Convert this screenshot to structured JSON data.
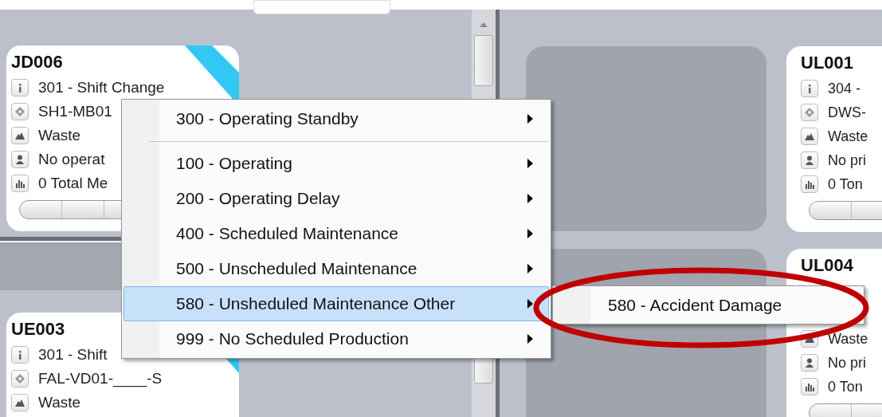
{
  "left_pane": {
    "cards": [
      {
        "title": "JD006",
        "color": "#33c8f4",
        "rows": [
          {
            "kind": "info",
            "text": "301 - Shift Change"
          },
          {
            "kind": "location",
            "text": "SH1-MB01"
          },
          {
            "kind": "material",
            "text": "Waste"
          },
          {
            "kind": "operator",
            "text": "No operat"
          },
          {
            "kind": "production",
            "text": "0 Total Me"
          }
        ]
      },
      {
        "title": "UE003",
        "color": "#33c8f4",
        "rows": [
          {
            "kind": "info",
            "text": "301 - Shift"
          },
          {
            "kind": "location",
            "text": "FAL-VD01-____-S"
          },
          {
            "kind": "material",
            "text": "Waste"
          }
        ]
      }
    ]
  },
  "right_pane": {
    "cards": [
      {
        "kind": "empty"
      },
      {
        "kind": "unit",
        "title": "UL001",
        "rows": [
          {
            "kind": "info",
            "text": "304 -"
          },
          {
            "kind": "location",
            "text": "DWS-"
          },
          {
            "kind": "material",
            "text": "Waste"
          },
          {
            "kind": "operator",
            "text": "No pri"
          },
          {
            "kind": "production",
            "text": "0 Ton"
          }
        ]
      },
      {
        "kind": "empty"
      },
      {
        "kind": "unit",
        "title": "UL004",
        "rows": [
          {
            "kind": "material",
            "text": "Waste"
          },
          {
            "kind": "operator",
            "text": "No pri"
          },
          {
            "kind": "production",
            "text": "0 Ton"
          }
        ]
      }
    ]
  },
  "context_menu": {
    "items": [
      {
        "kind": "item",
        "label": "300 - Operating Standby",
        "has_submenu": true,
        "selected": false
      },
      {
        "kind": "separator"
      },
      {
        "kind": "item",
        "label": "100 - Operating",
        "has_submenu": true,
        "selected": false
      },
      {
        "kind": "item",
        "label": "200 - Operating Delay",
        "has_submenu": true,
        "selected": false
      },
      {
        "kind": "item",
        "label": "400 - Scheduled Maintenance",
        "has_submenu": true,
        "selected": false
      },
      {
        "kind": "item",
        "label": "500 - Unscheduled Maintenance",
        "has_submenu": true,
        "selected": false
      },
      {
        "kind": "item",
        "label": "580 - Unsheduled Maintenance Other",
        "has_submenu": true,
        "selected": true
      },
      {
        "kind": "item",
        "label": "999 - No Scheduled Production",
        "has_submenu": true,
        "selected": false
      }
    ]
  },
  "submenu": {
    "items": [
      {
        "label": "580 - Accident Damage",
        "selected": false
      }
    ]
  },
  "annotation": {
    "kind": "ellipse",
    "color": "#c00000"
  }
}
